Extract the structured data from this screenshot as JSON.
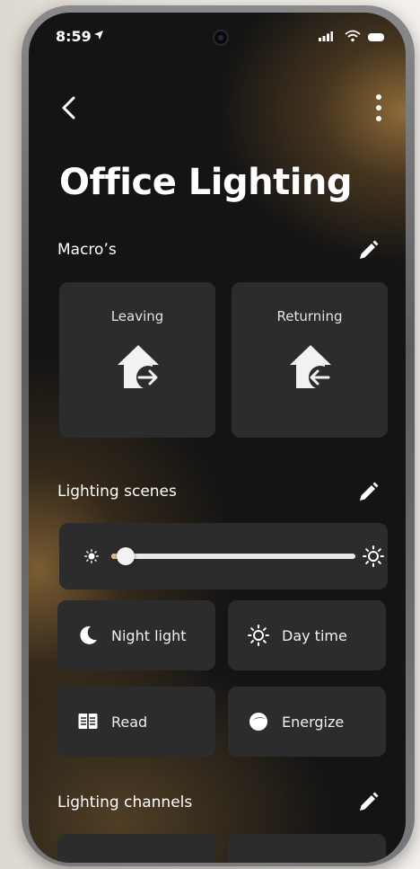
{
  "status_bar": {
    "time": "8:59",
    "icons": [
      "location-arrow-icon",
      "signal-icon",
      "wifi-icon",
      "battery-icon"
    ]
  },
  "header": {
    "title": "Office Lighting",
    "back_icon": "chevron-left-icon",
    "menu_icon": "more-vertical-icon"
  },
  "macros": {
    "label": "Macro’s",
    "items": [
      {
        "label": "Leaving",
        "icon": "home-leave-icon"
      },
      {
        "label": "Returning",
        "icon": "home-return-icon"
      }
    ]
  },
  "scenes": {
    "label": "Lighting scenes",
    "brightness": 0.06,
    "items": [
      {
        "label": "Night light",
        "icon": "moon-icon"
      },
      {
        "label": "Day time",
        "icon": "sun-icon"
      },
      {
        "label": "Read",
        "icon": "book-icon"
      },
      {
        "label": "Energize",
        "icon": "energize-icon"
      }
    ]
  },
  "channels": {
    "label": "Lighting channels"
  },
  "colors": {
    "screen_background": "#141414",
    "card_background": "#2c2c2c",
    "accent": "#e3b986",
    "text": "#ffffff"
  }
}
